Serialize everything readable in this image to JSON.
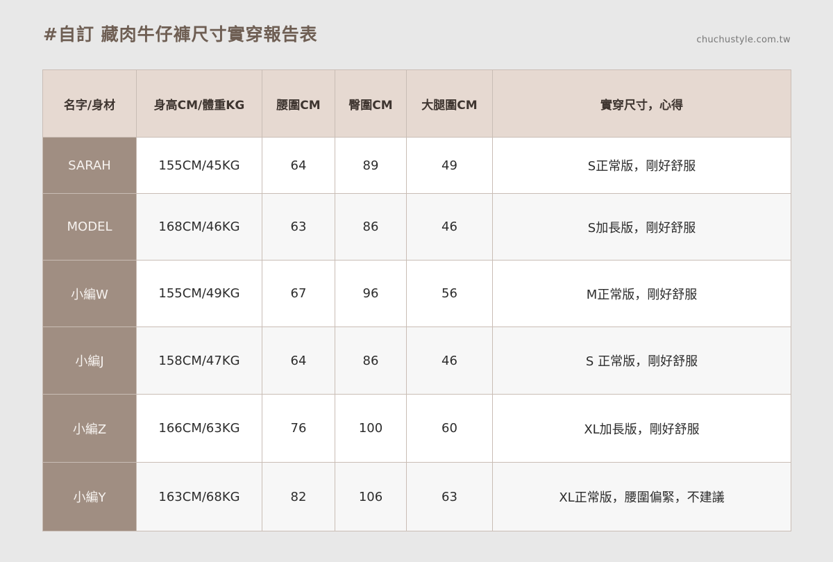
{
  "header": {
    "title": "#自訂 藏肉牛仔褲尺寸實穿報告表",
    "site": "chuchustyle.com.tw"
  },
  "table": {
    "columns": [
      "名字/身材",
      "身高CM/體重KG",
      "腰圍CM",
      "臀圍CM",
      "大腿圍CM",
      "實穿尺寸，心得"
    ],
    "rows": [
      {
        "name": "SARAH",
        "height_weight": "155CM/45KG",
        "waist": "64",
        "hip": "89",
        "thigh": "49",
        "note": "S正常版，剛好舒服"
      },
      {
        "name": "MODEL",
        "height_weight": "168CM/46KG",
        "waist": "63",
        "hip": "86",
        "thigh": "46",
        "note": "S加長版，剛好舒服"
      },
      {
        "name": "小編W",
        "height_weight": "155CM/49KG",
        "waist": "67",
        "hip": "96",
        "thigh": "56",
        "note": "M正常版，剛好舒服"
      },
      {
        "name": "小編J",
        "height_weight": "158CM/47KG",
        "waist": "64",
        "hip": "86",
        "thigh": "46",
        "note": "S 正常版，剛好舒服"
      },
      {
        "name": "小編Z",
        "height_weight": "166CM/63KG",
        "waist": "76",
        "hip": "100",
        "thigh": "60",
        "note": "XL加長版，剛好舒服"
      },
      {
        "name": "小編Y",
        "height_weight": "163CM/68KG",
        "waist": "82",
        "hip": "106",
        "thigh": "63",
        "note": "XL正常版，腰圍偏緊，不建議"
      }
    ]
  },
  "colors": {
    "background": "#e8e8e8",
    "header_fill": "#e6d9d1",
    "name_column_fill": "#a08e82",
    "title_text": "#6e5e53"
  }
}
